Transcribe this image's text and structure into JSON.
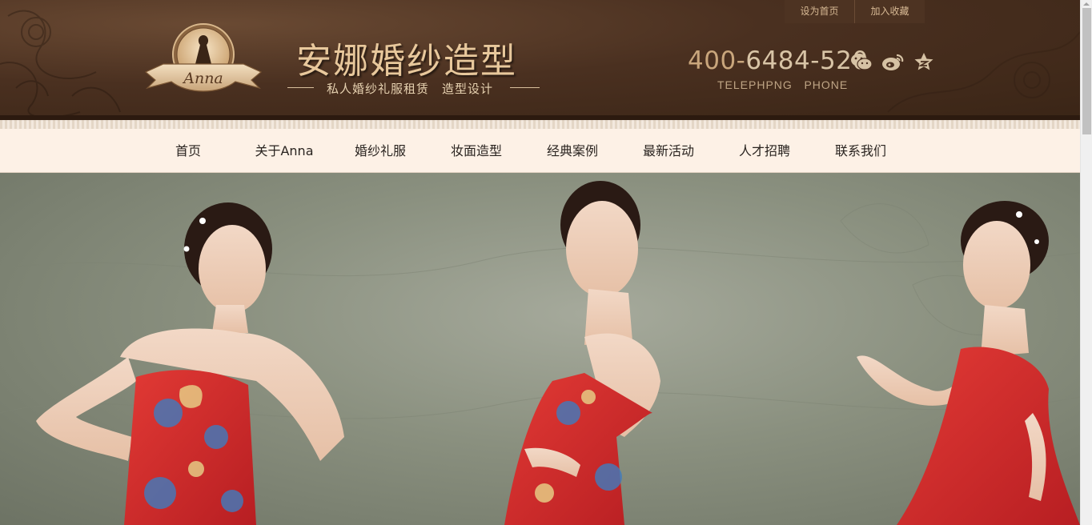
{
  "header": {
    "top_links": [
      "设为首页",
      "加入收藏"
    ],
    "brand": {
      "logo_text": "Anna",
      "title": "安娜婚纱造型",
      "subtitle_left": "私人婚纱礼服租赁",
      "subtitle_right": "造型设计"
    },
    "phone": {
      "prefix": "400-",
      "number": "6484-520",
      "label": "TELEPHPNG   PHONE"
    },
    "social_icons": [
      "wechat-icon",
      "weibo-icon",
      "qzone-icon"
    ]
  },
  "nav": {
    "items": [
      "首页",
      "关于Anna",
      "婚纱礼服",
      "妆面造型",
      "经典案例",
      "最新活动",
      "人才招聘",
      "联系我们"
    ]
  },
  "banner": {
    "description": "",
    "dress_color": "#d02a2a"
  },
  "colors": {
    "header_bg": "#4a3020",
    "gold": "#e8c89c",
    "nav_bg": "#fdf1e6"
  }
}
